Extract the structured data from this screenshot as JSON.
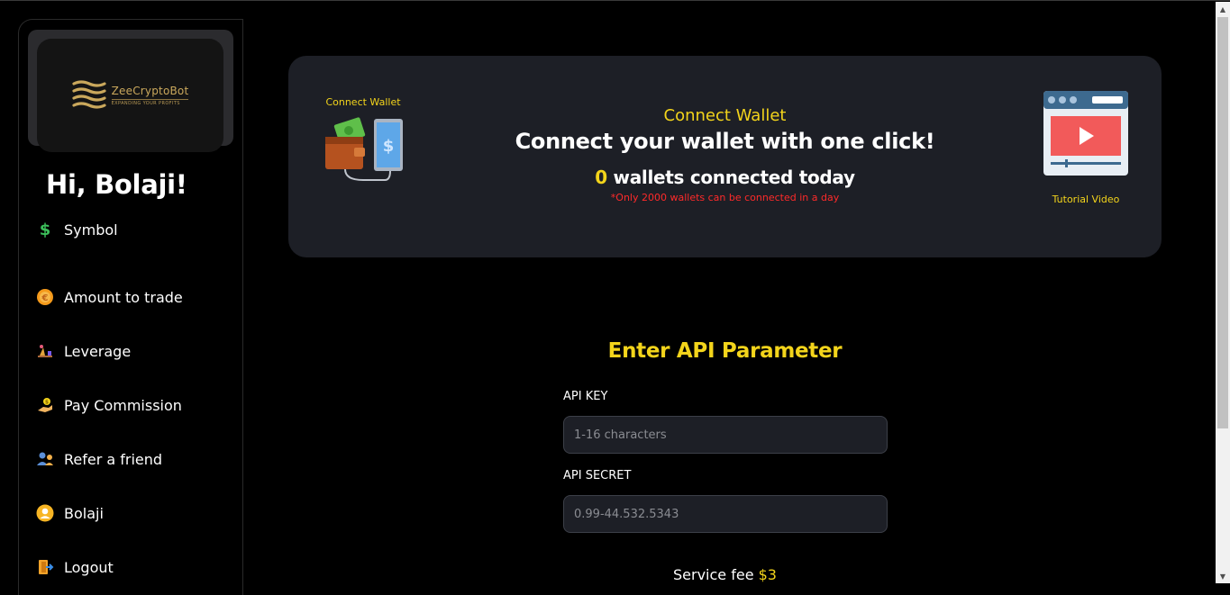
{
  "brand": {
    "name": "ZeeCryptoBot",
    "tagline": "EXPANDING YOUR PROFITS",
    "gold": "#caa85c"
  },
  "sidebar": {
    "greeting": "Hi, Bolaji!",
    "items": [
      {
        "label": "Symbol",
        "icon": "dollar-icon"
      },
      {
        "label": "Amount to trade",
        "icon": "coin-icon"
      },
      {
        "label": "Leverage",
        "icon": "leverage-icon"
      },
      {
        "label": "Pay Commission",
        "icon": "pay-hand-icon"
      },
      {
        "label": "Refer a friend",
        "icon": "refer-icon"
      },
      {
        "label": "Bolaji",
        "icon": "user-icon"
      },
      {
        "label": "Logout",
        "icon": "logout-icon"
      }
    ]
  },
  "banner": {
    "left_caption": "Connect Wallet",
    "kicker": "Connect Wallet",
    "title": "Connect your wallet with one click!",
    "count": "0",
    "count_suffix": " wallets connected today",
    "note": "*Only 2000 wallets can be connected in a day",
    "right_caption": "Tutorial Video"
  },
  "form": {
    "title": "Enter API Parameter",
    "api_key_label": "API KEY",
    "api_key_placeholder": "1-16 characters",
    "api_secret_label": "API SECRET",
    "api_secret_placeholder": "0.99-44.532.5343",
    "fee_label": "Service fee ",
    "fee_amount": "$3"
  },
  "colors": {
    "accent_yellow": "#f3d41b",
    "panel": "#1d1f26",
    "warning_red": "#ff2a2a"
  }
}
